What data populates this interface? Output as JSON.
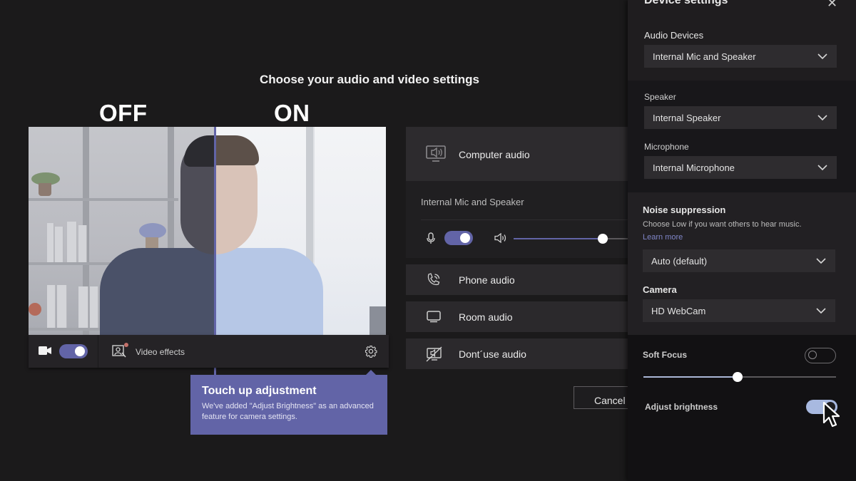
{
  "page": {
    "title": "Choose your audio and video settings",
    "compare_off": "OFF",
    "compare_on": "ON"
  },
  "preview": {
    "camera_on": true,
    "video_effects_label": "Video effects",
    "icons": {
      "camera": "video-camera-icon",
      "effects": "video-effects-icon",
      "settings": "gear-icon"
    }
  },
  "tooltip": {
    "title": "Touch up adjustment",
    "body": "We've added \"Adjust Brightness\" as an advanced feature for camera settings."
  },
  "audio_options": {
    "computer": {
      "label": "Computer audio",
      "icon": "computer-audio-icon"
    },
    "device_name": "Internal Mic and Speaker",
    "mic_on": true,
    "speaker_volume": 0.78,
    "phone": {
      "label": "Phone audio",
      "icon": "phone-audio-icon"
    },
    "room": {
      "label": "Room audio",
      "icon": "room-audio-icon"
    },
    "none": {
      "label": "Dont´use audio",
      "icon": "no-audio-icon"
    }
  },
  "cancel_label": "Cancel",
  "device_settings": {
    "title": "Device settings",
    "close_icon": "close-icon",
    "audio_devices_label": "Audio Devices",
    "audio_devices_value": "Internal Mic and Speaker",
    "speaker_label": "Speaker",
    "speaker_value": "Internal Speaker",
    "microphone_label": "Microphone",
    "microphone_value": "Internal Microphone",
    "noise_label": "Noise suppression",
    "noise_help": "Choose Low if you want others to hear music.",
    "learn_more": "Learn more",
    "noise_value": "Auto (default)",
    "camera_label": "Camera",
    "camera_value": "HD WebCam",
    "soft_focus_label": "Soft Focus",
    "soft_focus_on": false,
    "soft_focus_level": 0.49,
    "adjust_brightness_label": "Adjust brightness",
    "adjust_brightness_on": true
  },
  "colors": {
    "accent": "#6264a7",
    "background": "#1b1a1b",
    "panel": "#1f1d1f",
    "toggle_light": "#a8b9e0"
  }
}
